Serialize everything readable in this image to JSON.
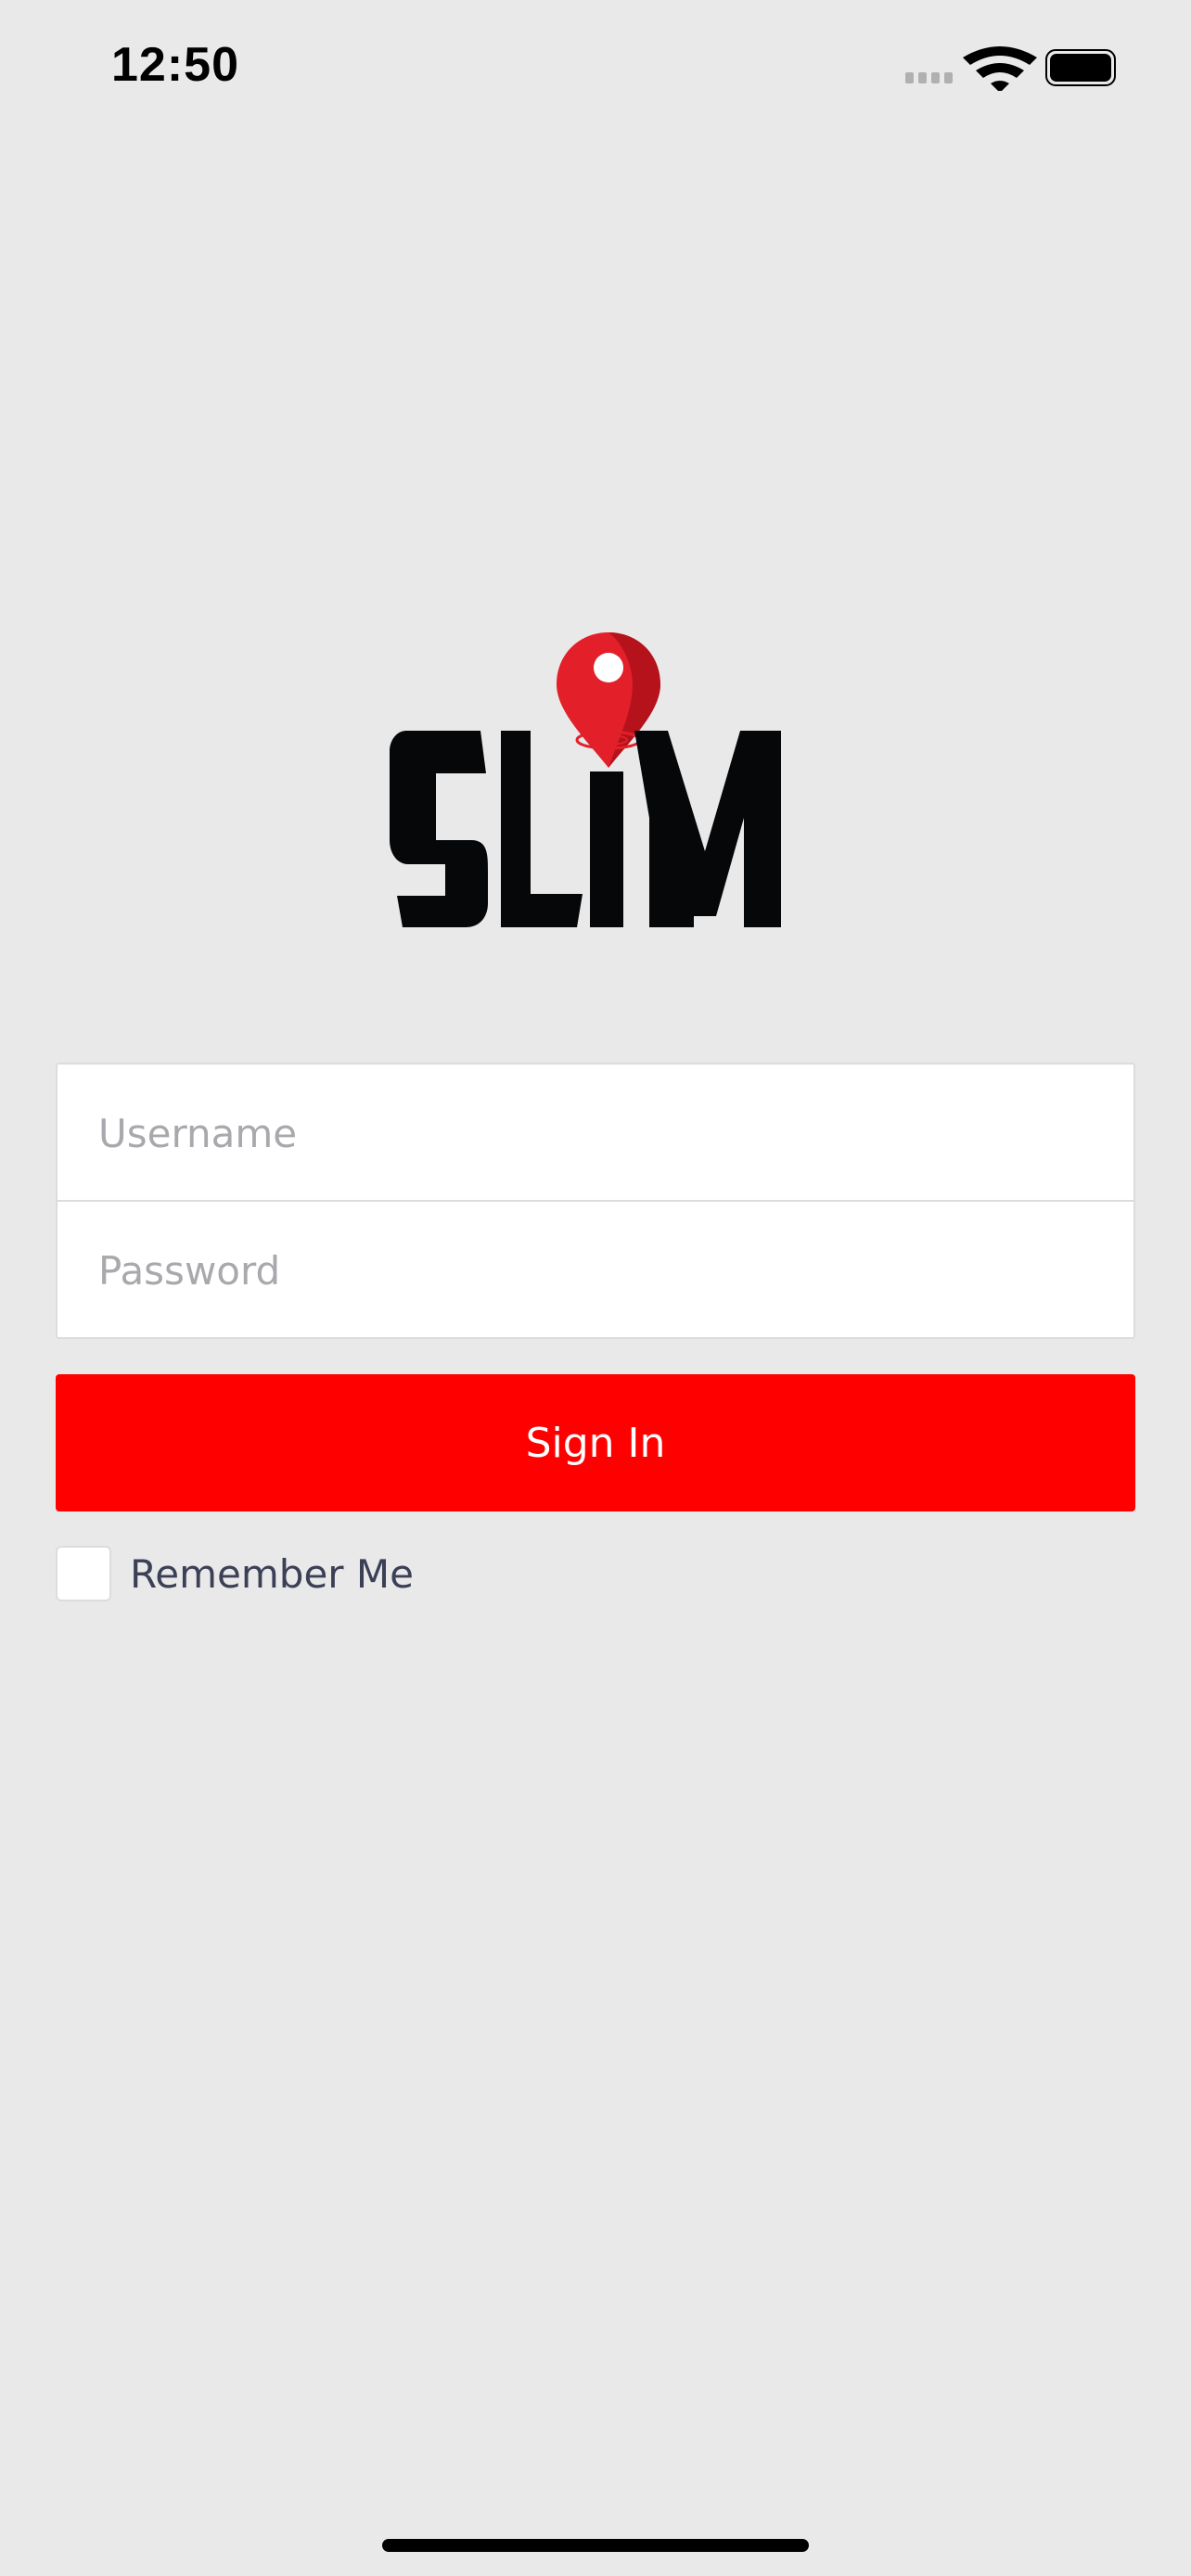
{
  "status_bar": {
    "time": "12:50",
    "icons": [
      "signal-icon",
      "wifi-icon",
      "battery-icon"
    ]
  },
  "logo": {
    "wordmark": "SLiM",
    "icon": "location-pin-icon",
    "colors": {
      "text": "#050708",
      "pin": "#e3202a",
      "pin_shade": "#b5121b"
    }
  },
  "form": {
    "username": {
      "value": "",
      "placeholder": "Username"
    },
    "password": {
      "value": "",
      "placeholder": "Password"
    },
    "sign_in_label": "Sign In",
    "remember_me": {
      "label": "Remember Me",
      "checked": false
    }
  },
  "colors": {
    "background": "#e9e9e9",
    "accent": "#ff0000",
    "label_text": "#3b4056",
    "placeholder": "#a9a9ad"
  }
}
